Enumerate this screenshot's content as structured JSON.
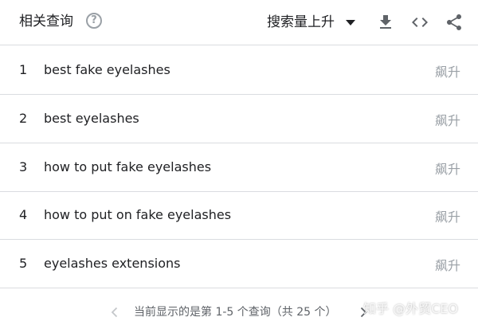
{
  "header": {
    "title": "相关查询",
    "help_icon": "help-circle-icon",
    "sort_label": "搜索量上升",
    "download_icon": "download-icon",
    "embed_icon": "code-embed-icon",
    "share_icon": "share-icon"
  },
  "rows": [
    {
      "rank": "1",
      "query": "best fake eyelashes",
      "value": "飙升"
    },
    {
      "rank": "2",
      "query": "best eyelashes",
      "value": "飙升"
    },
    {
      "rank": "3",
      "query": "how to put fake eyelashes",
      "value": "飙升"
    },
    {
      "rank": "4",
      "query": "how to put on fake eyelashes",
      "value": "飙升"
    },
    {
      "rank": "5",
      "query": "eyelashes extensions",
      "value": "飙升"
    }
  ],
  "footer": {
    "page_info": "当前显示的是第 1-5 个查询（共 25 个）",
    "prev_icon": "chevron-left-icon",
    "next_icon": "chevron-right-icon"
  },
  "watermark": "知乎 @外贸CEO",
  "colors": {
    "text": "#202124",
    "muted": "#9aa0a6",
    "divider": "#dadce0",
    "icon": "#5f6368"
  }
}
